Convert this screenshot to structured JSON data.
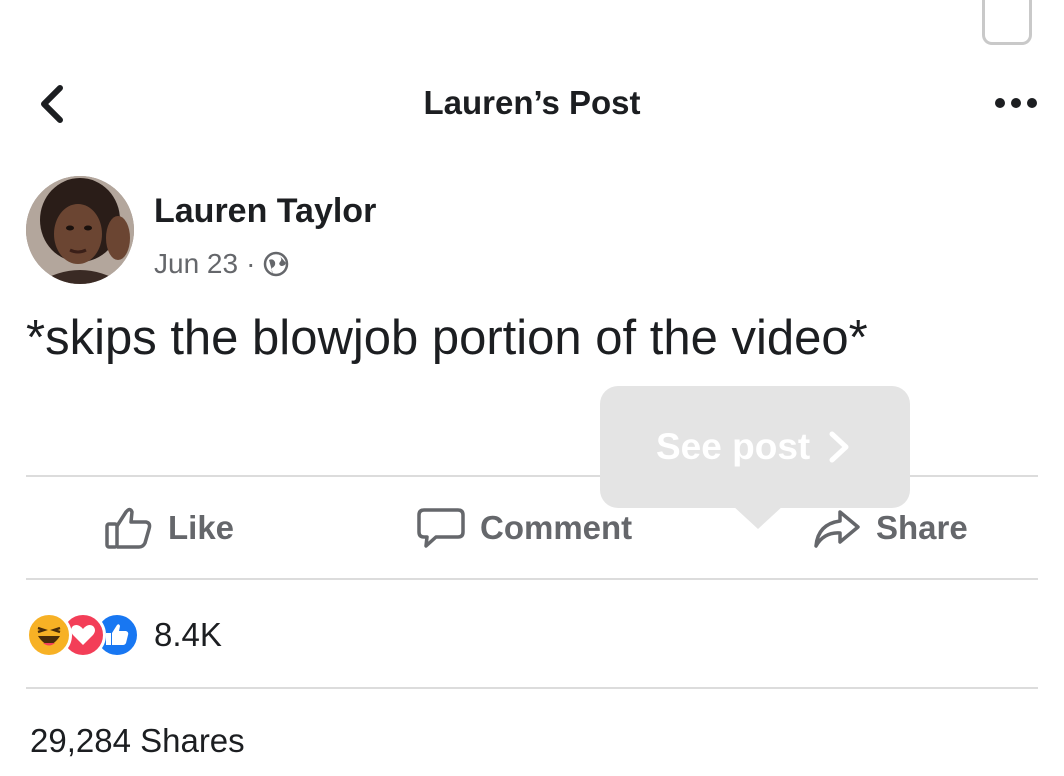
{
  "header": {
    "title": "Lauren’s Post"
  },
  "post": {
    "author": "Lauren Taylor",
    "date": "Jun 23",
    "separator": "·",
    "privacy_icon": "globe-icon",
    "text": "*skips the blowjob portion of the video*"
  },
  "actions": {
    "like_label": "Like",
    "comment_label": "Comment",
    "share_label": "Share"
  },
  "tooltip": {
    "label": "See post"
  },
  "stats": {
    "reactions": [
      "haha",
      "love",
      "like"
    ],
    "reaction_count": "8.4K",
    "shares_label": "29,284 Shares"
  },
  "colors": {
    "like_blue": "#1877f2",
    "love_red": "#f33e58",
    "haha_yellow": "#f7b125",
    "muted_text": "#65676b",
    "tooltip_bg": "#e4e4e4"
  }
}
